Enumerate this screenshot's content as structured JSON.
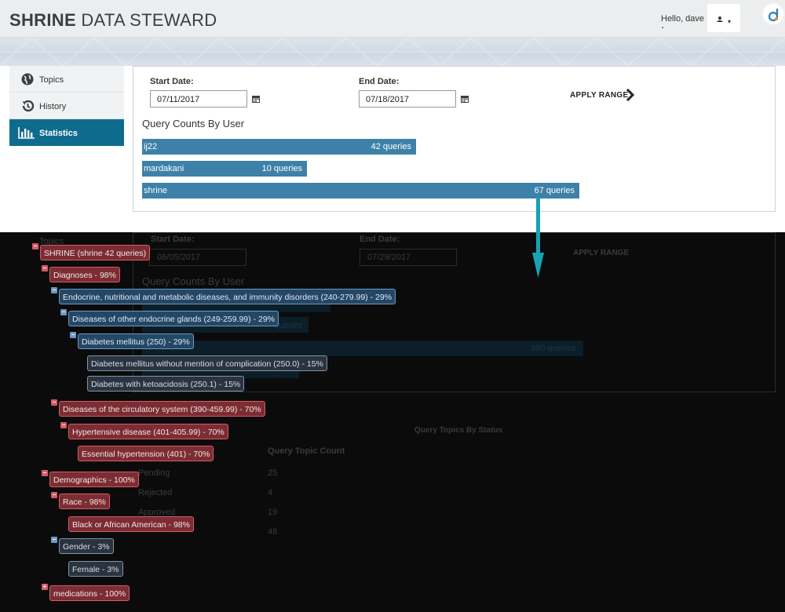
{
  "header": {
    "brand_bold": "SHRINE",
    "brand_rest": " DATA STEWARD",
    "greeting": "Hello, dave",
    "caret": "▾"
  },
  "sidebar": {
    "items": [
      {
        "label": "Topics",
        "icon": "globe-icon",
        "active": false
      },
      {
        "label": "History",
        "icon": "history-icon",
        "active": false
      },
      {
        "label": "Statistics",
        "icon": "bar-chart-icon",
        "active": true
      }
    ]
  },
  "panel": {
    "start_label": "Start Date:",
    "start_value": "07/11/2017",
    "end_label": "End Date:",
    "end_value": "07/18/2017",
    "apply_label": "APPLY RANGE",
    "section_title": "Query Counts By User",
    "users": [
      {
        "name": "ij22",
        "count": 42,
        "count_label": "42 queries"
      },
      {
        "name": "mardakani",
        "count": 10,
        "count_label": "10 queries"
      },
      {
        "name": "shrine",
        "count": 67,
        "count_label": "67 queries"
      }
    ]
  },
  "background": {
    "topics": "Topics",
    "start_label": "Start Date:",
    "start_value": "06/05/2017",
    "end_label": "End Date:",
    "end_value": "07/29/2017",
    "apply_label": "APPLY RANGE",
    "section_title": "Query Counts By User",
    "bar_label_1": "queries",
    "bar_label_2": "380 queries",
    "status_title": "Query Topics By Status",
    "count_header": "Query Topic Count",
    "rows": [
      {
        "status": "Pending",
        "count": "25"
      },
      {
        "status": "Rejected",
        "count": "4"
      },
      {
        "status": "Approved",
        "count": "19"
      },
      {
        "status": "",
        "count": "48"
      }
    ]
  },
  "tree": {
    "toggle_collapse": "−",
    "toggle_expand": "+",
    "nodes": [
      {
        "label": "SHRINE (shrine 42 queries)",
        "style": "red"
      },
      {
        "label": "Diagnoses - 98%",
        "style": "red"
      },
      {
        "label": "Endocrine, nutritional and metabolic diseases, and immunity disorders (240-279.99) - 29%",
        "style": "blue"
      },
      {
        "label": "Diseases of other endocrine glands (249-259.99) - 29%",
        "style": "blue"
      },
      {
        "label": "Diabetes mellitus (250) - 29%",
        "style": "blue"
      },
      {
        "label": "Diabetes mellitus without mention of complication (250.0) - 15%",
        "style": "gray"
      },
      {
        "label": "Diabetes with ketoacidosis (250.1) - 15%",
        "style": "gray"
      },
      {
        "label": "Diseases of the circulatory system (390-459.99) - 70%",
        "style": "red"
      },
      {
        "label": "Hypertensive disease (401-405.99) - 70%",
        "style": "red"
      },
      {
        "label": "Essential hypertension (401) - 70%",
        "style": "red"
      },
      {
        "label": "Demographics - 100%",
        "style": "red"
      },
      {
        "label": "Race - 98%",
        "style": "red"
      },
      {
        "label": "Black or African American - 98%",
        "style": "red"
      },
      {
        "label": "Gender - 3%",
        "style": "gray"
      },
      {
        "label": "Female - 3%",
        "style": "gray"
      },
      {
        "label": "medications - 100%",
        "style": "red"
      }
    ]
  },
  "colors": {
    "accent": "#0f6b8e",
    "bar": "#3d81a9",
    "arrow": "#18a3b4",
    "tree_red": "#d55b65",
    "tree_blue": "#6c9ac2"
  }
}
